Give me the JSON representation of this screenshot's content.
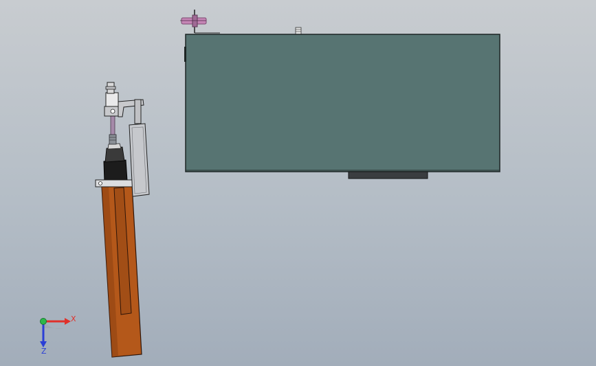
{
  "app": {
    "type": "cad-3d-viewport"
  },
  "triad": {
    "x_label": "X",
    "z_label": "Z",
    "colors": {
      "x": "#e0302a",
      "y": "#2db84a",
      "z": "#2b3fd6"
    }
  },
  "model": {
    "panel_color": "#577472",
    "cylinder_color": "#b4581a",
    "bracket_color": "#c6c8cc"
  }
}
